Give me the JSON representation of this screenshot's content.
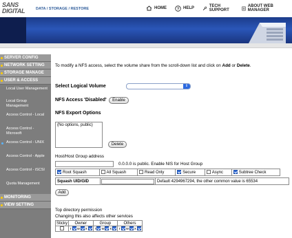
{
  "header": {
    "logo_line1": "SANS",
    "logo_line2": "DIGITAL",
    "breadcrumb": "DATA / STORAGE / RESTORE",
    "nav": [
      {
        "label": "HOME",
        "icon": "home-icon"
      },
      {
        "label": "HELP",
        "icon": "help-icon"
      },
      {
        "label": "TECH SUPPORT",
        "icon": "wrench-icon"
      },
      {
        "label": "ABOUT WEB MANAGER",
        "icon": "document-icon"
      }
    ]
  },
  "sidebar": {
    "items": [
      {
        "label": "SERVER CONFIG",
        "type": "main"
      },
      {
        "label": "NETWORK SETTING",
        "type": "main"
      },
      {
        "label": "STORAGE MANAGE",
        "type": "main"
      },
      {
        "label": "USER & ACCESS",
        "type": "main"
      },
      {
        "label": "Local User Management",
        "type": "sub"
      },
      {
        "label": "Local Group Management",
        "type": "sub"
      },
      {
        "label": "Access Control - Local",
        "type": "sub"
      },
      {
        "label": "Access Control - Microsoft",
        "type": "sub"
      },
      {
        "label": "Access Control - UNIX",
        "type": "sub",
        "active": true
      },
      {
        "label": "Access Control - Apple",
        "type": "sub"
      },
      {
        "label": "Access Control - iSCSI",
        "type": "sub"
      },
      {
        "label": "Quota Management",
        "type": "sub"
      },
      {
        "label": "MONITORING",
        "type": "main"
      },
      {
        "label": "VIEW SETTING",
        "type": "main"
      }
    ]
  },
  "main": {
    "intro_text_1": "To modify a NFS access, select the volume share from the scroll-down list and click on ",
    "intro_add": "Add",
    "intro_or": " or ",
    "intro_delete": "Delete",
    "intro_end": ".",
    "select_volume_label": "Select Logical Volume",
    "select_volume_value": "",
    "nfs_access_label": "NFS Access 'Disabled'",
    "enable_button": "Enable",
    "export_options_label": "NFS Export Options",
    "export_options_list": [
      "(No options, public)"
    ],
    "delete_button": "Delete",
    "host_label": "Host/Host Group address",
    "host_value": "",
    "host_hint": "0.0.0.0 is public. Enable NIS for Host Group",
    "options": [
      {
        "label": "Root Squash",
        "checked": true
      },
      {
        "label": "All Squash",
        "checked": false
      },
      {
        "label": "Read Only",
        "checked": false
      },
      {
        "label": "Secure",
        "checked": true
      },
      {
        "label": "Async",
        "checked": false
      },
      {
        "label": "Subtree Check",
        "checked": true
      }
    ],
    "squash_label": "Squash UID/GID",
    "squash_value": "",
    "squash_hint": "Default 4294967294, the other common value is 65534",
    "add_button": "Add",
    "top_perm_label": "Top directory permission",
    "top_perm_hint": "Changing this also affects other services",
    "perm_headers": [
      "Sticky",
      "Owner",
      "Group",
      "Others"
    ],
    "perm_letters": [
      "r",
      "w",
      "x"
    ]
  },
  "colors": {
    "banner": "#2a56b8",
    "sidebar_bg": "#7d7d7d",
    "sidebar_main_bg": "#9a9a9a",
    "accent_dot": "#ffcc00",
    "checkbox_checked": "#2f6ad8",
    "link": "#2d5b9a"
  }
}
